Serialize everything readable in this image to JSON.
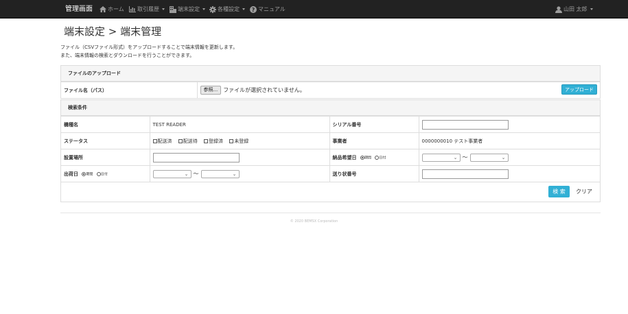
{
  "nav": {
    "brand": "管理画面",
    "items": [
      {
        "label": "ホーム",
        "icon": "home-icon"
      },
      {
        "label": "取引履歴",
        "icon": "bar-chart-icon"
      },
      {
        "label": "端末設定",
        "icon": "building-icon"
      },
      {
        "label": "各種設定",
        "icon": "gear-icon"
      },
      {
        "label": "マニュアル",
        "icon": "question-icon"
      }
    ],
    "user": "山田 太郎"
  },
  "page": {
    "title": "端末設定 > 端末管理",
    "desc_line1": "ファイル（CSVファイル形式）をアップロードすることで端末情報を更新します。",
    "desc_line2": "また、端末情報の検索とダウンロードを行うことができます。"
  },
  "upload": {
    "heading": "ファイルのアップロード",
    "file_label": "ファイル名（パス）",
    "browse_label": "参照...",
    "no_file_text": "ファイルが選択されていません。",
    "upload_button": "アップロード"
  },
  "search": {
    "heading": "検索条件",
    "model_label": "機種名",
    "model_value": "TEST READER",
    "serial_label": "シリアル番号",
    "serial_value": "",
    "status_label": "ステータス",
    "status_options": [
      "配送済",
      "配送待",
      "登録済",
      "未登録"
    ],
    "business_label": "事業者",
    "business_value": "0000000010 テスト事業者",
    "location_label": "設置場所",
    "location_value": "",
    "delivery_label": "納品希望日",
    "range_label": "期間",
    "date_label": "日付",
    "ship_label": "出荷日",
    "tracking_label": "送り状番号",
    "tracking_value": "",
    "tilde": "〜",
    "search_button": "検 索",
    "clear_button": "クリア"
  },
  "footer": {
    "copyright": "© 2020 BEMSX Corporation"
  },
  "colors": {
    "navbar": "#222222",
    "accent": "#31b0d5"
  }
}
